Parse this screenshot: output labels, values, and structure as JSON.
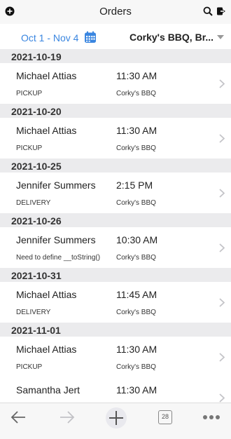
{
  "header": {
    "title": "Orders"
  },
  "filter": {
    "date_range": "Oct 1 - Nov 4",
    "location": "Corky's BBQ, Br..."
  },
  "groups": [
    {
      "date": "2021-10-19",
      "orders": [
        {
          "name": "Michael Attias",
          "time": "11:30 AM",
          "type": "PICKUP",
          "store": "Corky's BBQ"
        }
      ]
    },
    {
      "date": "2021-10-20",
      "orders": [
        {
          "name": "Michael Attias",
          "time": "11:30 AM",
          "type": "PICKUP",
          "store": "Corky's BBQ"
        }
      ]
    },
    {
      "date": "2021-10-25",
      "orders": [
        {
          "name": "Jennifer Summers",
          "time": "2:15 PM",
          "type": "DELIVERY",
          "store": "Corky's BBQ"
        }
      ]
    },
    {
      "date": "2021-10-26",
      "orders": [
        {
          "name": "Jennifer Summers",
          "time": "10:30 AM",
          "type": "Need to define __toString()",
          "store": "Corky's BBQ"
        }
      ]
    },
    {
      "date": "2021-10-31",
      "orders": [
        {
          "name": "Michael Attias",
          "time": "11:45 AM",
          "type": "DELIVERY",
          "store": "Corky's BBQ"
        }
      ]
    },
    {
      "date": "2021-11-01",
      "orders": [
        {
          "name": "Michael Attias",
          "time": "11:30 AM",
          "type": "PICKUP",
          "store": "Corky's BBQ"
        },
        {
          "name": "Samantha Jert",
          "time": "11:30 AM",
          "type": "",
          "store": ""
        }
      ]
    }
  ],
  "toolbar": {
    "today_label": "28"
  },
  "colors": {
    "accent": "#3a86e0",
    "section_bg": "#ebebed",
    "toolbar_bg": "#f7f7f7"
  }
}
